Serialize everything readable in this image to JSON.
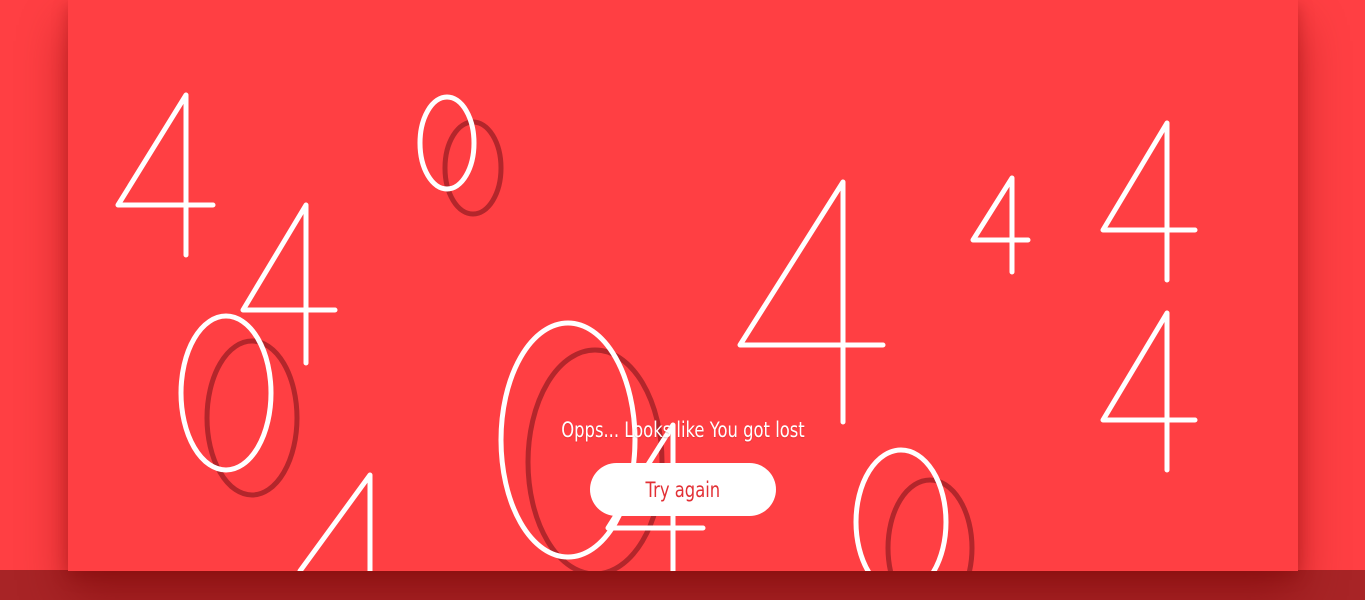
{
  "background_color": "#ff3f43",
  "digit_color": "#ffffff",
  "digit_shadow_color": "#b3262b",
  "message": "Opps... Looks like You got lost",
  "button": {
    "label": "Try again",
    "text_color": "#e23035",
    "background": "#ffffff"
  },
  "floating_digits": [
    "4",
    "0",
    "4",
    "0",
    "4",
    "4",
    "4",
    "4",
    "0",
    "0",
    "4",
    "4"
  ]
}
